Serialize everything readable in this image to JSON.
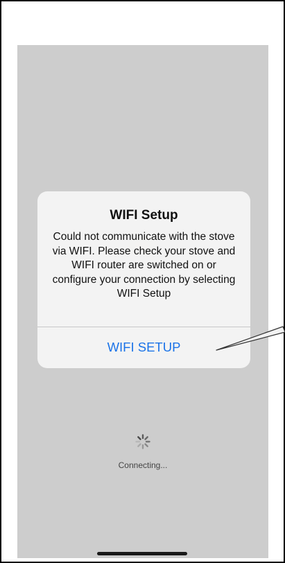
{
  "alert": {
    "title": "WIFI Setup",
    "message": "Could not communicate with the stove via WIFI. Please check your stove and WIFI router are switched on or configure your connection by selecting WIFI Setup",
    "button_label": "WIFI SETUP"
  },
  "status": {
    "icon": "spinner-icon",
    "text": "Connecting..."
  },
  "colors": {
    "background": "#cdcdcd",
    "accent": "#1a73e8"
  }
}
